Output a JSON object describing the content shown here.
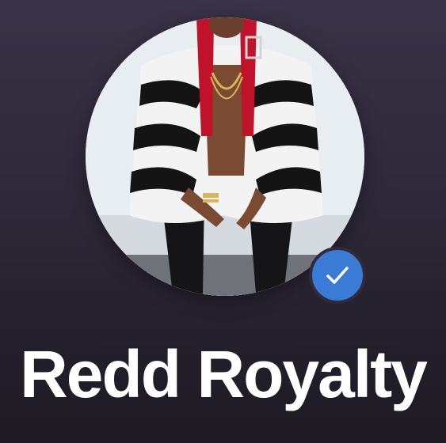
{
  "artist": {
    "name": "Redd Royalty",
    "verified": true
  },
  "icons": {
    "verified_badge": "verified-check-icon"
  },
  "colors": {
    "background_top": "#3a3347",
    "background_bottom": "#1d1a23",
    "badge": "#3a7bd5",
    "name_text": "#ffffff"
  }
}
